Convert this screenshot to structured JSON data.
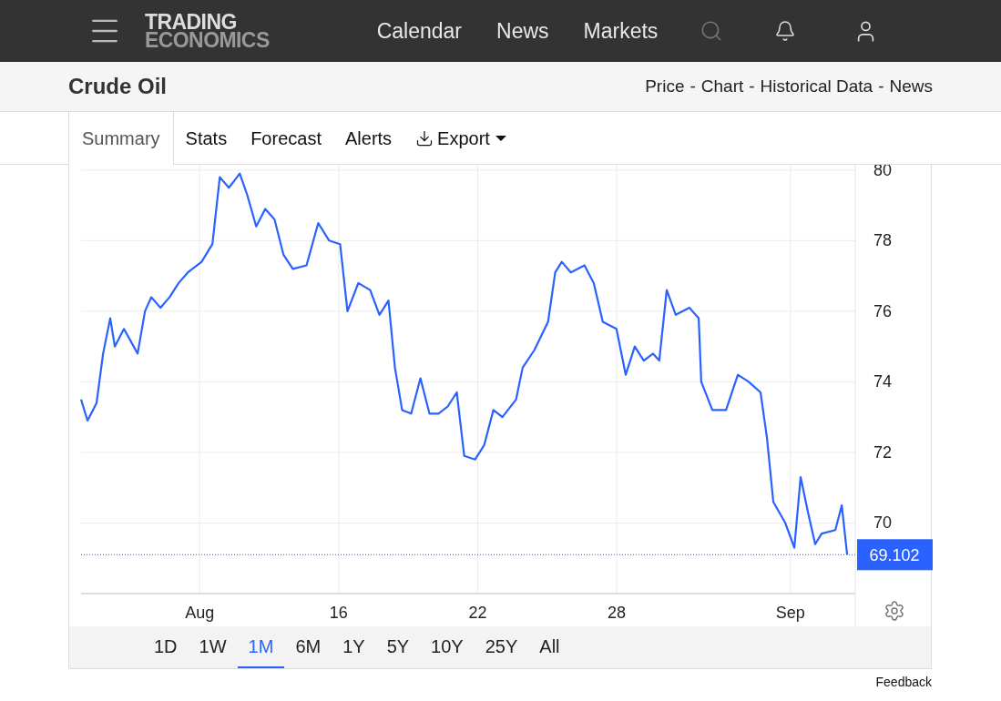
{
  "header": {
    "logo_line_1": "TRADING",
    "logo_line_2": "ECONOMICS",
    "nav": [
      "Calendar",
      "News",
      "Markets"
    ]
  },
  "title_bar": {
    "title": "Crude Oil",
    "links": [
      "Price",
      "Chart",
      "Historical Data",
      "News"
    ],
    "separator": "-"
  },
  "tabs": [
    {
      "label": "Summary",
      "selected": true
    },
    {
      "label": "Stats",
      "selected": false
    },
    {
      "label": "Forecast",
      "selected": false
    },
    {
      "label": "Alerts",
      "selected": false
    },
    {
      "label": "Export",
      "selected": false,
      "kind": "dropdown"
    }
  ],
  "chart": {
    "chart_data": {
      "type": "line",
      "x": [
        4.88,
        5.16,
        5.55,
        5.83,
        6.14,
        6.34,
        6.73,
        7.32,
        7.64,
        7.91,
        8.31,
        8.7,
        9.09,
        9.49,
        10.08,
        10.55,
        10.87,
        11.26,
        11.73,
        12.05,
        12.44,
        12.83,
        13.23,
        13.62,
        14.02,
        14.61,
        15.12,
        15.59,
        16.06,
        16.38,
        16.85,
        17.36,
        17.76,
        18.15,
        18.43,
        18.74,
        19.13,
        19.53,
        19.92,
        20.31,
        20.71,
        21.1,
        21.42,
        21.89,
        22.28,
        22.68,
        23.07,
        23.66,
        23.94,
        24.45,
        25.04,
        25.35,
        25.63,
        26.02,
        26.61,
        27.01,
        27.4,
        27.99,
        28.39,
        28.78,
        29.17,
        29.57,
        29.84,
        30.16,
        30.55,
        31.14,
        31.54,
        31.65,
        32.13,
        32.72,
        33.23,
        33.7,
        34.21,
        34.49,
        34.76,
        35.28,
        35.67,
        35.94,
        36.26,
        36.57,
        36.85,
        37.44,
        37.72,
        37.95
      ],
      "series": [
        {
          "color": "#2962ff",
          "values": [
            73.5,
            72.9,
            73.4,
            74.8,
            75.8,
            75.0,
            75.5,
            74.8,
            76.0,
            76.4,
            76.1,
            76.4,
            76.8,
            77.1,
            77.4,
            77.9,
            79.8,
            79.5,
            79.9,
            79.3,
            78.4,
            78.9,
            78.6,
            77.6,
            77.2,
            77.3,
            78.5,
            78.0,
            77.9,
            76.0,
            76.8,
            76.6,
            75.9,
            76.3,
            74.4,
            73.2,
            73.1,
            74.1,
            73.1,
            73.1,
            73.3,
            73.7,
            71.9,
            71.8,
            72.2,
            73.2,
            73.0,
            73.5,
            74.4,
            74.9,
            75.7,
            77.1,
            77.4,
            77.1,
            77.3,
            76.8,
            75.7,
            75.5,
            74.2,
            75.0,
            74.6,
            74.8,
            74.6,
            76.6,
            75.9,
            76.1,
            75.8,
            74.0,
            73.2,
            73.2,
            74.2,
            74.0,
            73.7,
            72.4,
            70.6,
            70.0,
            69.3,
            71.3,
            70.3,
            69.4,
            69.7,
            69.8,
            70.5,
            69.1
          ]
        }
      ],
      "xlim": [
        4.88,
        38.3
      ],
      "ylim": [
        68,
        80.15
      ],
      "xticks": [
        {
          "value": 10,
          "label": "Aug"
        },
        16,
        22,
        28,
        {
          "value": 35.5,
          "label": "Sep"
        }
      ],
      "yticks": [
        70,
        72,
        74,
        76,
        78,
        80
      ],
      "grid": true,
      "ref_lines": [
        {
          "axis": "y",
          "value": 69.102,
          "label": "69.102"
        }
      ]
    }
  },
  "ranges": [
    {
      "label": "1D",
      "selected": false
    },
    {
      "label": "1W",
      "selected": false
    },
    {
      "label": "1M",
      "selected": true
    },
    {
      "label": "6M",
      "selected": false
    },
    {
      "label": "1Y",
      "selected": false
    },
    {
      "label": "5Y",
      "selected": false
    },
    {
      "label": "10Y",
      "selected": false
    },
    {
      "label": "25Y",
      "selected": false
    },
    {
      "label": "All",
      "selected": false
    }
  ],
  "feedback": "Feedback"
}
